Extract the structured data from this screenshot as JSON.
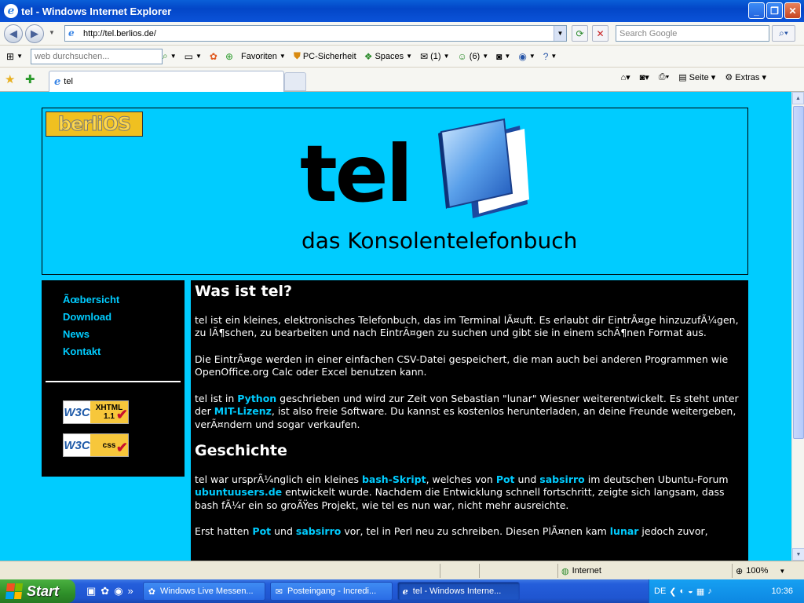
{
  "window": {
    "title": "tel - Windows Internet Explorer"
  },
  "address_bar": {
    "url": "http://tel.berlios.de/",
    "search_placeholder": "Search Google"
  },
  "toolbar": {
    "web_search_placeholder": "web durchsuchen...",
    "favorites_label": "Favoriten",
    "security_label": "PC-Sicherheit",
    "spaces_label": "Spaces",
    "mail_count": "(1)",
    "contacts_count": "(6)"
  },
  "tabs": {
    "active_tab_label": "tel",
    "page_label": "Seite",
    "extras_label": "Extras"
  },
  "page": {
    "logo_text": "berliOS",
    "title": "tel",
    "subtitle": "das Konsolentelefonbuch",
    "nav": [
      {
        "label": "Ãœbersicht"
      },
      {
        "label": "Download"
      },
      {
        "label": "News"
      },
      {
        "label": "Kontakt"
      }
    ],
    "badges": {
      "xhtml": {
        "w3c": "W3C",
        "label": "XHTML 1.1"
      },
      "css": {
        "w3c": "W3C",
        "label": "css"
      }
    },
    "heading1": "Was ist tel?",
    "p1": "tel ist ein kleines, elektronisches Telefonbuch, das im Terminal lÃ¤uft. Es erlaubt dir EintrÃ¤ge hinzuzufÃ¼gen, zu lÃ¶schen, zu bearbeiten und nach EintrÃ¤gen zu suchen und gibt sie in einem schÃ¶nen Format aus.",
    "p2": "Die EintrÃ¤ge werden in einer einfachen CSV-Datei gespeichert, die man auch bei anderen Programmen wie OpenOffice.org Calc oder Excel benutzen kann.",
    "p3": {
      "t1": "tel ist in ",
      "link1": "Python",
      "t2": " geschrieben und wird zur Zeit von Sebastian \"lunar\" Wiesner weiterentwickelt. Es steht unter der ",
      "link2": "MIT-Lizenz",
      "t3": ", ist also freie Software. Du kannst es kostenlos herunterladen, an deine Freunde weitergeben, verÃ¤ndern und sogar verkaufen."
    },
    "heading2": "Geschichte",
    "p4": {
      "t1": "tel war ursprÃ¼nglich ein kleines ",
      "link1": "bash-Skript",
      "t2": ", welches von ",
      "link2": "Pot",
      "t3": " und ",
      "link3": "sabsirro",
      "t4": " im deutschen Ubuntu-Forum ",
      "link4": "ubuntuusers.de",
      "t5": " entwickelt wurde. Nachdem die Entwicklung schnell fortschritt, zeigte sich langsam, dass bash fÃ¼r ein so groÃŸes Projekt, wie tel es nun war, nicht mehr ausreichte."
    },
    "p5": {
      "t1": "Erst hatten ",
      "link1": "Pot",
      "t2": " und ",
      "link2": "sabsirro",
      "t3": " vor, tel in Perl neu zu schreiben. Diesen PlÃ¤nen kam ",
      "link3": "lunar",
      "t4": " jedoch zuvor,"
    }
  },
  "status_bar": {
    "zone": "Internet",
    "zoom": "100%"
  },
  "taskbar": {
    "start_label": "Start",
    "tasks": [
      {
        "label": "Windows Live Messen..."
      },
      {
        "label": "Posteingang - Incredi..."
      },
      {
        "label": "tel - Windows Interne..."
      }
    ],
    "language": "DE",
    "clock": "10:36"
  },
  "colors": {
    "page_background": "#00ccff",
    "content_background": "#000000",
    "link": "#00ccff"
  }
}
